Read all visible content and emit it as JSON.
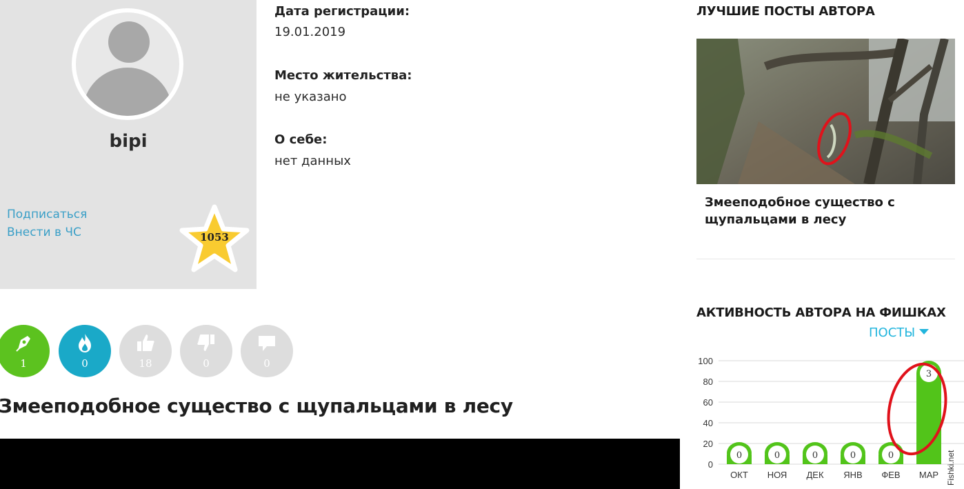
{
  "profile": {
    "username": "bipi",
    "subscribe_link": "Подписаться",
    "blacklist_link": "Внести в ЧС",
    "rating": "1053"
  },
  "info": {
    "registration_label": "Дата регистрации:",
    "registration_value": "19.01.2019",
    "location_label": "Место жительства:",
    "location_value": "не указано",
    "about_label": "О себе:",
    "about_value": "нет данных"
  },
  "stats": [
    {
      "icon": "pen-icon",
      "value": "1",
      "color": "#5cc21f"
    },
    {
      "icon": "fire-icon",
      "value": "0",
      "color": "#1aa9c8"
    },
    {
      "icon": "thumbs-up-icon",
      "value": "18",
      "color": "#dddddd"
    },
    {
      "icon": "thumbs-down-icon",
      "value": "0",
      "color": "#dddddd"
    },
    {
      "icon": "comment-icon",
      "value": "0",
      "color": "#dddddd"
    }
  ],
  "post_title": "Змееподобное существо с щупальцами в лесу",
  "sidebar": {
    "best_posts_heading": "ЛУЧШИЕ ПОСТЫ АВТОРА",
    "best_post_title": "Змееподобное существо с щупальцами в лесу",
    "activity_heading": "АКТИВНОСТЬ АВТОРА НА ФИШКАХ",
    "activity_dropdown": "ПОСТЫ"
  },
  "chart_data": {
    "type": "bar",
    "categories": [
      "ОКТ",
      "НОЯ",
      "ДЕК",
      "ЯНВ",
      "ФЕВ",
      "МАР"
    ],
    "values": [
      0,
      0,
      0,
      0,
      0,
      3
    ],
    "bar_fill_percent": [
      0,
      0,
      0,
      0,
      0,
      100
    ],
    "yticks": [
      "0",
      "20",
      "40",
      "60",
      "80",
      "100"
    ],
    "ylim": [
      0,
      100
    ],
    "grid": true,
    "bar_color": "#52c41a",
    "annotation": "red hand-drawn circle around МАР bar"
  },
  "colors": {
    "accent_green": "#5cc21f",
    "accent_blue": "#1aa9c8",
    "link_blue": "#3a9fc7",
    "dropdown_blue": "#22b5dd",
    "star_yellow": "#f9cb30",
    "highlight_red": "#e0121b"
  },
  "watermark": "Fishki.net"
}
